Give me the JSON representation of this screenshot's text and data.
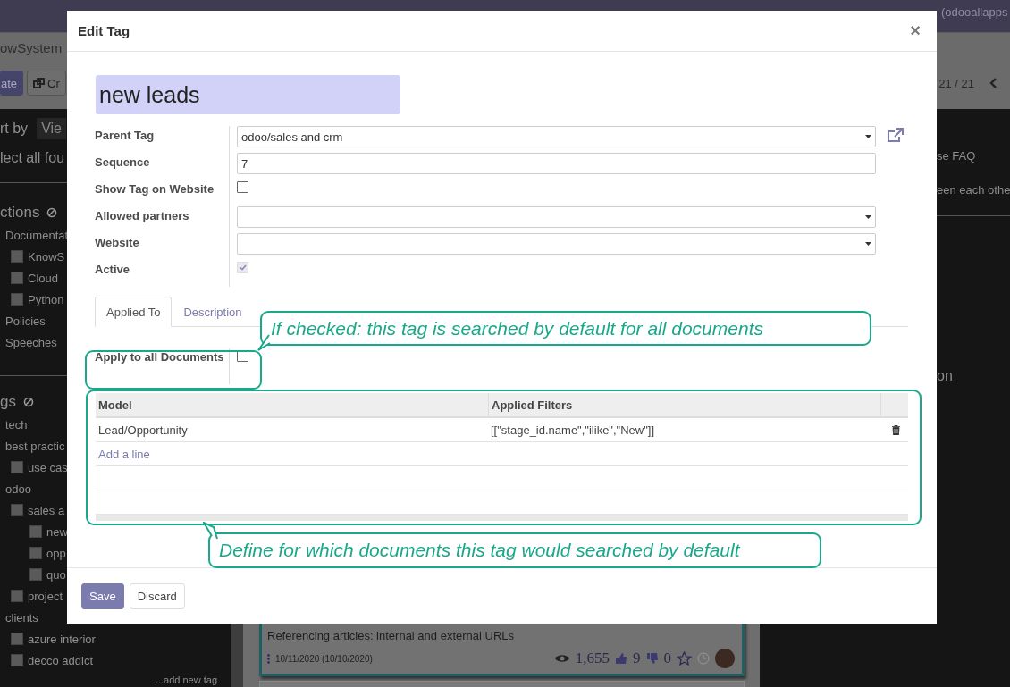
{
  "top_bar": {
    "user": "(odooallapps"
  },
  "breadcrumb": "owSystem",
  "control_buttons": [
    {
      "label": "ate",
      "kind": "primary"
    },
    {
      "label": "Cr",
      "kind": "secondary"
    }
  ],
  "pager": "21 / 21",
  "sort": {
    "label": "rt by",
    "view_button": "Vie"
  },
  "select_all": "lect all fou",
  "sections": {
    "title": "ctions",
    "items": [
      {
        "label": "Documentat",
        "children": [
          {
            "label": "KnowS",
            "checked": false
          },
          {
            "label": "Cloud",
            "checked": false
          },
          {
            "label": "Python",
            "checked": false
          }
        ]
      },
      {
        "label": "Policies"
      },
      {
        "label": "Speeches"
      }
    ]
  },
  "tags": {
    "title": "gs",
    "items": [
      {
        "label": "tech"
      },
      {
        "label": "best practic",
        "children": [
          {
            "label": "use cas",
            "checked": false
          }
        ]
      },
      {
        "label": "odoo",
        "children": [
          {
            "label": "sales a",
            "checked": false,
            "children": [
              {
                "label": "new",
                "checked": false
              },
              {
                "label": "opp",
                "checked": false
              },
              {
                "label": "quo",
                "checked": false
              }
            ]
          },
          {
            "label": "project",
            "checked": false
          }
        ]
      },
      {
        "label": "clients",
        "children": [
          {
            "label": "azure interior",
            "checked": false
          },
          {
            "label": "decco addict",
            "checked": false
          }
        ]
      }
    ],
    "add": "...add new tag"
  },
  "right_panel": {
    "lines": [
      "se FAQ",
      "een each othe"
    ],
    "heading": "on"
  },
  "card": {
    "title": "Referencing articles: internal and external URLs",
    "date": "10/11/2020 (10/10/2020)",
    "views": "1,655",
    "likes": "9",
    "dislikes": "0"
  },
  "dialog": {
    "title": "Edit Tag",
    "close": "×",
    "name": "new leads",
    "fields": [
      {
        "kind": "select",
        "label": "Parent Tag",
        "value": "odoo/sales and crm",
        "external_link": true,
        "disabled": false
      },
      {
        "kind": "text",
        "label": "Sequence",
        "value": "7",
        "disabled": false
      },
      {
        "kind": "checkbox",
        "label": "Show Tag on Website",
        "checked": false,
        "disabled": false
      },
      {
        "kind": "select",
        "label": "Allowed partners",
        "external_link": false,
        "disabled": false
      },
      {
        "kind": "select",
        "label": "Website",
        "external_link": false,
        "disabled": false
      },
      {
        "kind": "checkbox",
        "label": "Active",
        "checked": true,
        "disabled": true
      }
    ],
    "tabs": [
      {
        "label": "Applied To",
        "selected": true
      },
      {
        "label": "Description",
        "selected": false
      }
    ],
    "apply_all": {
      "label": "Apply to all Documents",
      "checked": false
    },
    "table": {
      "columns": [
        "Model",
        "Applied Filters"
      ],
      "rows": [
        {
          "model": "Lead/Opportunity",
          "filters": "[[\"stage_id.name\",\"ilike\",\"New\"]]"
        }
      ],
      "add_line": "Add a line"
    },
    "buttons": [
      {
        "label": "Save",
        "kind": "primary"
      },
      {
        "label": "Discard",
        "kind": "secondary"
      }
    ]
  },
  "annotations": {
    "checkbox_hint": "If checked: this tag is searched by default for all documents",
    "table_hint": "Define for which documents this tag would searched by default"
  }
}
